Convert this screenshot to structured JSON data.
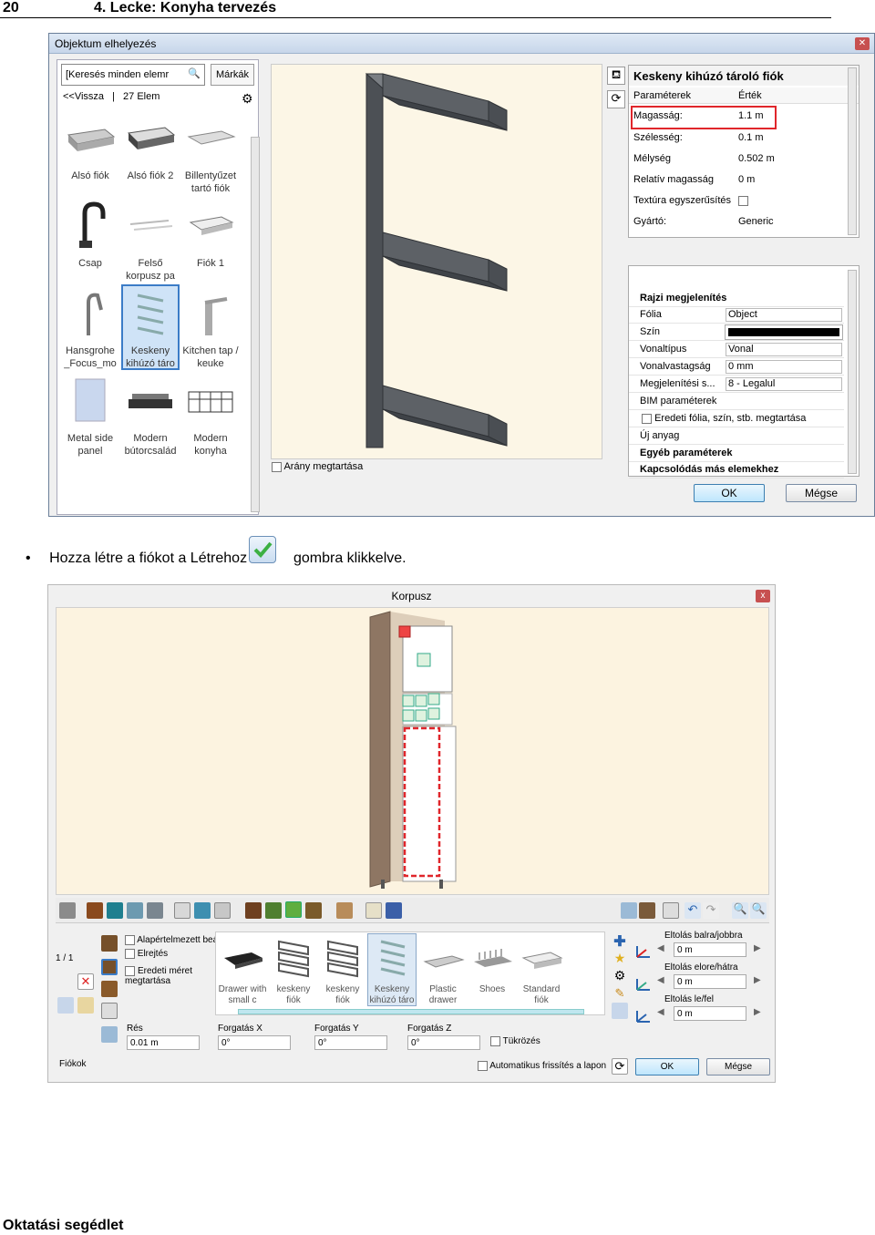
{
  "header": {
    "page_number": "20",
    "chapter": "4. Lecke: Konyha tervezés"
  },
  "footer": {
    "text": "Oktatási segédlet"
  },
  "dialog1": {
    "title": "Objektum elhelyezés",
    "search_placeholder": "[Keresés minden elemr",
    "brands_button": "Márkák",
    "back_link": "<<Vissza",
    "item_count": "27 Elem",
    "items": [
      "Alsó fiók",
      "Alsó fiók 2",
      "Billentyűzet tartó fiók",
      "Csap",
      "Felső korpusz pa",
      "Fiók 1",
      "Hansgrohe _Focus_mo",
      "Keskeny kihúzó táro",
      "Kitchen tap / keuke",
      "Metal side panel",
      "Modern bútorcsalád",
      "Modern konyha"
    ],
    "selected_item": "Keskeny kihúzó táro",
    "keep_ratio": "Arány megtartása",
    "prop_title": "Keskeny kihúzó tároló fiók",
    "prop_col_param": "Paraméterek",
    "prop_col_value": "Érték",
    "properties": [
      {
        "k": "Magasság:",
        "v": "1.1 m"
      },
      {
        "k": "Szélesség:",
        "v": "0.1 m"
      },
      {
        "k": "Mélység",
        "v": "0.502 m"
      },
      {
        "k": "Relatív magasság",
        "v": "0 m"
      },
      {
        "k": "Textúra egyszerűsítés",
        "v": ""
      },
      {
        "k": "Gyártó:",
        "v": "Generic"
      }
    ],
    "drawing_section": "Rajzi megjelenítés",
    "attributes": [
      {
        "k": "Fólia",
        "v": "Object"
      },
      {
        "k": "Szín",
        "v": ""
      },
      {
        "k": "Vonaltípus",
        "v": "Vonal"
      },
      {
        "k": "Vonalvastagság",
        "v": "0 mm"
      },
      {
        "k": "Megjelenítési s...",
        "v": "8 - Legalul"
      },
      {
        "k": "BIM paraméterek",
        "v": ""
      }
    ],
    "keep_original": "Eredeti fólia, szín, stb. megtartása",
    "new_material": "Új anyag",
    "other_params": "Egyéb paraméterek",
    "connections": "Kapcsolódás más elemekhez",
    "ok": "OK",
    "cancel": "Mégse"
  },
  "bullet": {
    "before": "Hozza létre a fiókot a Létrehoz",
    "after": "gombra klikkelve."
  },
  "dialog2": {
    "title": "Korpusz",
    "close": "x",
    "page_indicator": "1 / 1",
    "opt_default": "Alapértelmezett beáll",
    "opt_hide": "Elrejtés",
    "opt_keep_size": "Eredeti méret megtartása",
    "items": [
      "Drawer with small c",
      "keskeny fiók",
      "keskeny fiók",
      "Keskeny kihúzó táro",
      "Plastic drawer",
      "Shoes",
      "Standard fiók"
    ],
    "gap_label": "Rés",
    "gap_value": "0.01 m",
    "rot_x_label": "Forgatás X",
    "rot_x_value": "0°",
    "rot_y_label": "Forgatás Y",
    "rot_y_value": "0°",
    "rot_z_label": "Forgatás Z",
    "rot_z_value": "0°",
    "mirror": "Tükrözés",
    "shift_lr_label": "Eltolás balra/jobbra",
    "shift_lr_value": "0 m",
    "shift_fb_label": "Eltolás elore/hátra",
    "shift_fb_value": "0 m",
    "shift_ud_label": "Eltolás le/fel",
    "shift_ud_value": "0 m",
    "tab_label": "Fiókok",
    "auto_refresh": "Automatikus frissítés a lapon",
    "ok": "OK",
    "cancel": "Mégse"
  }
}
